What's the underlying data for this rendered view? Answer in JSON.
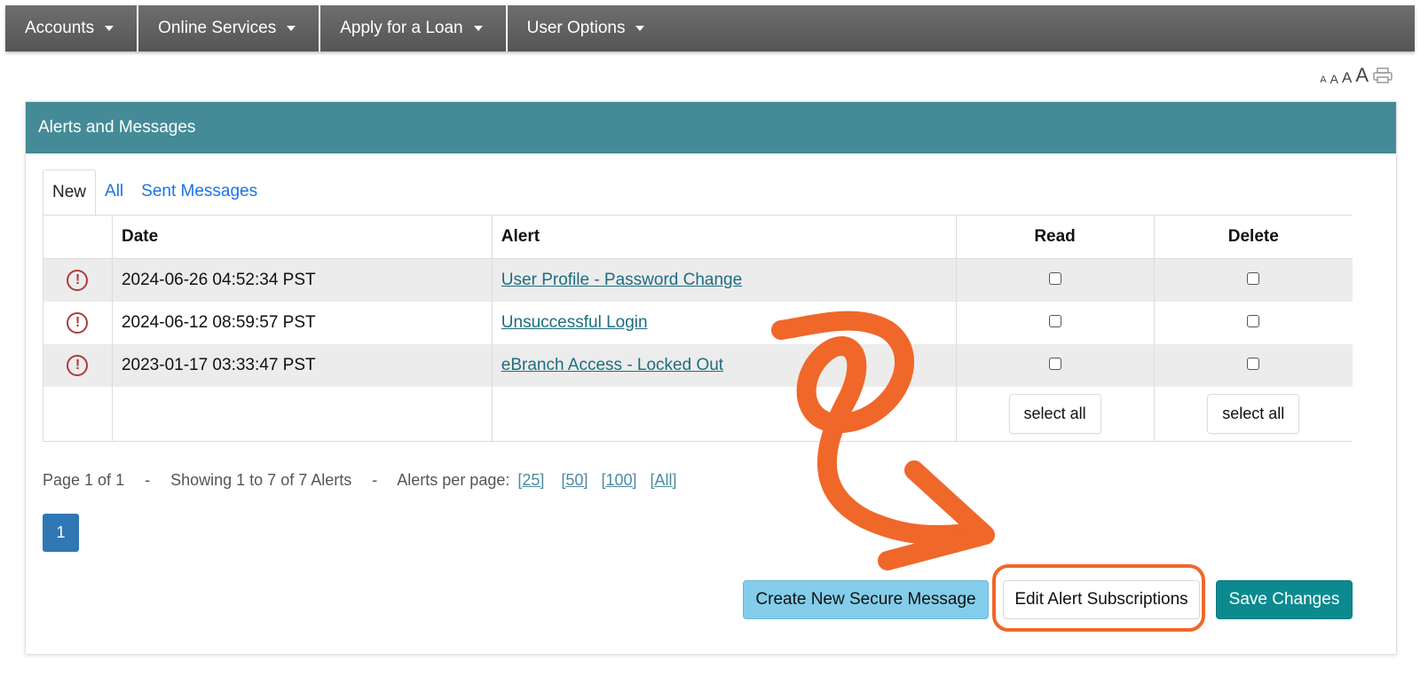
{
  "nav": {
    "items": [
      {
        "label": "Accounts"
      },
      {
        "label": "Online Services"
      },
      {
        "label": "Apply for a Loan"
      },
      {
        "label": "User Options"
      }
    ]
  },
  "font_size_controls": [
    "A",
    "A",
    "A",
    "A"
  ],
  "panel": {
    "title": "Alerts and Messages",
    "tabs": [
      {
        "label": "New",
        "active": true
      },
      {
        "label": "All",
        "active": false
      },
      {
        "label": "Sent Messages",
        "active": false
      }
    ],
    "table": {
      "headers": [
        "",
        "Date",
        "Alert",
        "Read",
        "Delete"
      ],
      "rows": [
        {
          "date": "2024-06-26 04:52:34 PST",
          "alert": "User Profile - Password Change"
        },
        {
          "date": "2024-06-12 08:59:57 PST",
          "alert": "Unsuccessful Login"
        },
        {
          "date": "2023-01-17 03:33:47 PST",
          "alert": "eBranch Access - Locked Out"
        }
      ],
      "select_all_read": "select all",
      "select_all_delete": "select all"
    },
    "pager": {
      "page_text": "Page 1 of 1",
      "separator": "-",
      "showing_text": "Showing 1 to 7 of 7 Alerts",
      "per_page_label": "Alerts per page:",
      "per_page_options": [
        "[25]",
        "[50]",
        "[100]",
        "[All]"
      ],
      "current_page": "1"
    },
    "buttons": {
      "create": "Create New Secure Message",
      "edit": "Edit Alert Subscriptions",
      "save": "Save Changes"
    }
  },
  "colors": {
    "nav_bg": "#5f5f5f",
    "panel_header": "#448b97",
    "create_button": "#84cdea",
    "save_button": "#0c8a8f",
    "page_button": "#2f77b5",
    "annotation": "#f0672a",
    "warning_icon": "#b03a3a"
  }
}
